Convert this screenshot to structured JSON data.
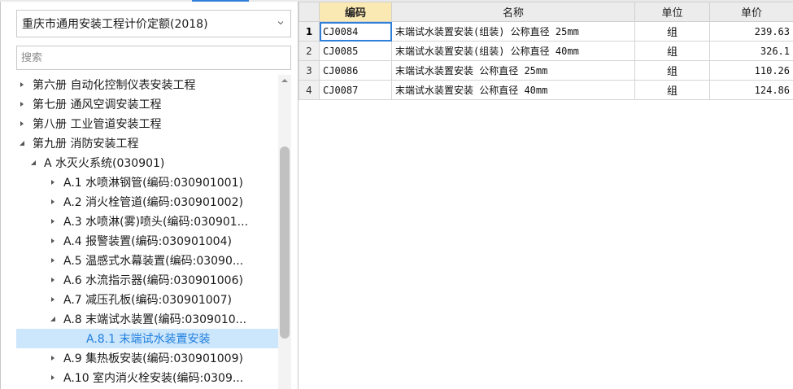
{
  "left_panel": {
    "quota_select": {
      "selected": "重庆市通用安装工程计价定额(2018)"
    },
    "search": {
      "placeholder": "搜索",
      "value": ""
    },
    "tree": [
      {
        "label": "第六册 自动化控制仪表安装工程",
        "level": 0,
        "state": "collapsed"
      },
      {
        "label": "第七册 通风空调安装工程",
        "level": 0,
        "state": "collapsed"
      },
      {
        "label": "第八册 工业管道安装工程",
        "level": 0,
        "state": "collapsed"
      },
      {
        "label": "第九册 消防安装工程",
        "level": 0,
        "state": "expanded"
      },
      {
        "label": "A 水灭火系统(030901)",
        "level": 1,
        "state": "expanded"
      },
      {
        "label": "A.1 水喷淋钢管(编码:030901001)",
        "level": 2,
        "state": "collapsed"
      },
      {
        "label": "A.2 消火栓管道(编码:030901002)",
        "level": 2,
        "state": "collapsed"
      },
      {
        "label": "A.3 水喷淋(雾)喷头(编码:030901...",
        "level": 2,
        "state": "collapsed"
      },
      {
        "label": "A.4 报警装置(编码:030901004)",
        "level": 2,
        "state": "collapsed"
      },
      {
        "label": "A.5 温感式水幕装置(编码:03090...",
        "level": 2,
        "state": "collapsed"
      },
      {
        "label": "A.6 水流指示器(编码:030901006)",
        "level": 2,
        "state": "collapsed"
      },
      {
        "label": "A.7 减压孔板(编码:030901007)",
        "level": 2,
        "state": "collapsed"
      },
      {
        "label": "A.8 末端试水装置(编码:0309010...",
        "level": 2,
        "state": "expanded"
      },
      {
        "label": "A.8.1 末端试水装置安装",
        "level": 3,
        "state": "leaf",
        "selected": true
      },
      {
        "label": "A.9 集热板安装(编码:030901009)",
        "level": 2,
        "state": "collapsed"
      },
      {
        "label": "A.10 室内消火栓安装(编码:0309...",
        "level": 2,
        "state": "collapsed"
      }
    ]
  },
  "grid": {
    "columns": [
      "编码",
      "名称",
      "单位",
      "单价"
    ],
    "rows": [
      {
        "num": "1",
        "code": "CJ0084",
        "name": "末端试水装置安装(组装) 公称直径 25mm",
        "unit": "组",
        "price": "239.63"
      },
      {
        "num": "2",
        "code": "CJ0085",
        "name": "末端试水装置安装(组装) 公称直径 40mm",
        "unit": "组",
        "price": "326.1"
      },
      {
        "num": "3",
        "code": "CJ0086",
        "name": "末端试水装置安装 公称直径 25mm",
        "unit": "组",
        "price": "110.26"
      },
      {
        "num": "4",
        "code": "CJ0087",
        "name": "末端试水装置安装 公称直径 40mm",
        "unit": "组",
        "price": "124.86"
      }
    ]
  },
  "colors": {
    "accent": "#2f7fd8",
    "selected_bg": "#cce6fb",
    "sorted_header": "#fbe9b4"
  }
}
